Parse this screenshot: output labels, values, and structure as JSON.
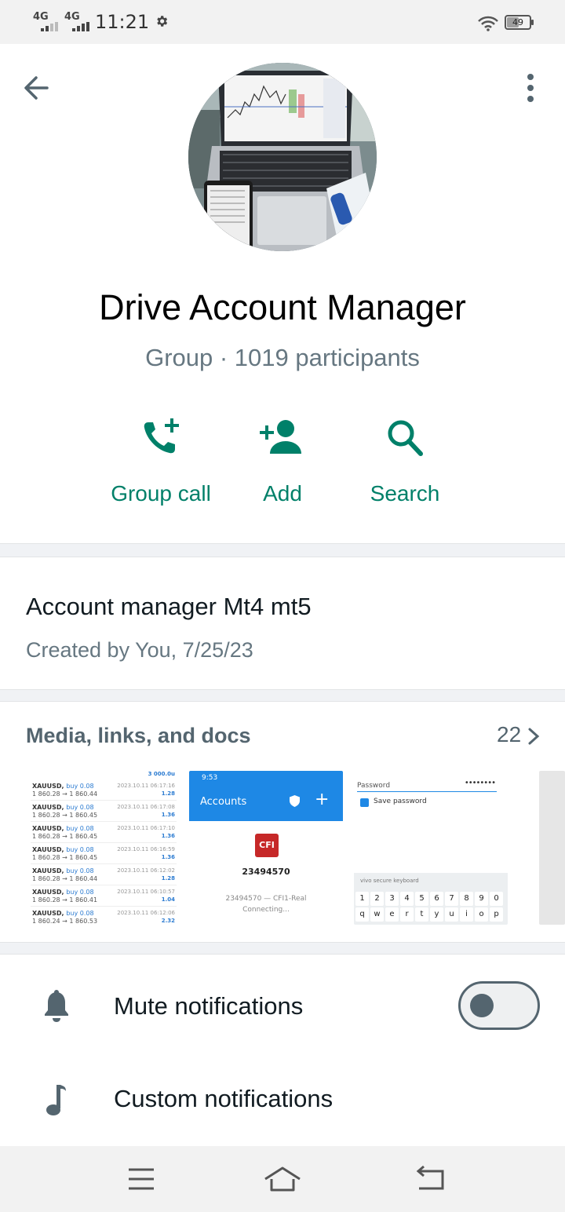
{
  "status_bar": {
    "signal1": "4G",
    "signal2": "4G",
    "time": "11:21",
    "battery": "49",
    "battery_level": 0.49,
    "icons": [
      "gear-icon",
      "wifi-icon",
      "battery-icon"
    ]
  },
  "header": {
    "back_icon": "arrow-left-icon",
    "menu_icon": "more-vertical-icon",
    "avatar": "group-photo"
  },
  "group": {
    "name": "Drive Account Manager",
    "subtitle": "Group · 1019 participants"
  },
  "actions": [
    {
      "label": "Group call",
      "icon": "phone-add-icon"
    },
    {
      "label": "Add",
      "icon": "person-add-icon"
    },
    {
      "label": "Search",
      "icon": "search-icon"
    }
  ],
  "description": {
    "text": "Account manager Mt4 mt5",
    "created": "Created by You, 7/25/23"
  },
  "media": {
    "title": "Media, links, and docs",
    "count": "22",
    "thumb1": {
      "top": "3 000.0u",
      "rows": [
        {
          "sym": "XAUUSD,",
          "side": "buy 0.08",
          "px": "1 860.28 → 1 860.44",
          "dt": "2023.10.11 06:17:16",
          "pf": "1.28"
        },
        {
          "sym": "XAUUSD,",
          "side": "buy 0.08",
          "px": "1 860.28 → 1 860.45",
          "dt": "2023.10.11 06:17:08",
          "pf": "1.36"
        },
        {
          "sym": "XAUUSD,",
          "side": "buy 0.08",
          "px": "1 860.28 → 1 860.45",
          "dt": "2023.10.11 06:17:10",
          "pf": "1.36"
        },
        {
          "sym": "XAUUSD,",
          "side": "buy 0.08",
          "px": "1 860.28 → 1 860.45",
          "dt": "2023.10.11 06:16:59",
          "pf": "1.36"
        },
        {
          "sym": "XAUUSD,",
          "side": "buy 0.08",
          "px": "1 860.28 → 1 860.44",
          "dt": "2023.10.11 06:12:02",
          "pf": "1.28"
        },
        {
          "sym": "XAUUSD,",
          "side": "buy 0.08",
          "px": "1 860.28 → 1 860.41",
          "dt": "2023.10.11 06:10:57",
          "pf": "1.04"
        },
        {
          "sym": "XAUUSD,",
          "side": "buy 0.08",
          "px": "1 860.24 → 1 860.53",
          "dt": "2023.10.11 06:12:06",
          "pf": "2.32"
        }
      ]
    },
    "thumb2": {
      "time": "9:53",
      "title": "Accounts",
      "logo": "CFI",
      "number": "23494570",
      "server": "23494570 — CFI1-Real",
      "status": "Connecting..."
    },
    "thumb3": {
      "password_label": "Password",
      "password_dots": "••••••••",
      "save_password": "Save password",
      "keyboard_title": "vivo secure keyboard",
      "keys": [
        "1",
        "2",
        "3",
        "4",
        "5",
        "6",
        "7",
        "8",
        "9",
        "0",
        "q",
        "w",
        "e",
        "r",
        "t",
        "y",
        "u",
        "i",
        "o",
        "p"
      ]
    }
  },
  "settings": {
    "mute": {
      "label": "Mute notifications",
      "icon": "bell-icon",
      "enabled": false
    },
    "custom": {
      "label": "Custom notifications",
      "icon": "music-note-icon"
    }
  },
  "navbar": {
    "icons": [
      "menu-icon",
      "home-icon",
      "back-icon"
    ]
  },
  "colors": {
    "accent": "#008069",
    "secondary_text": "#667781",
    "divider": "#f0f2f5"
  }
}
